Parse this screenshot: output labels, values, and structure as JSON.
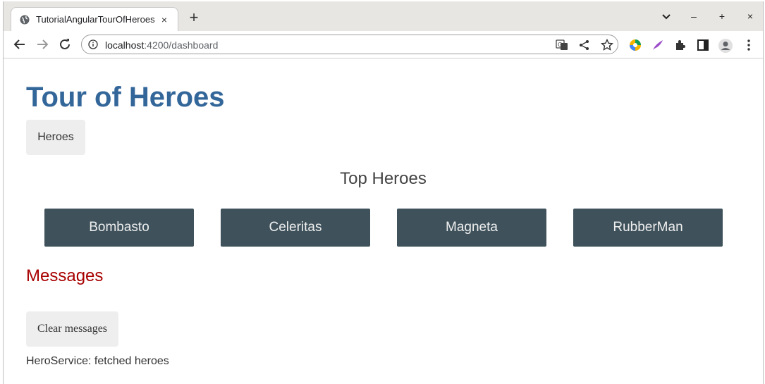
{
  "browser": {
    "tab_title": "TutorialAngularTourOfHeroes",
    "tab_close": "×",
    "new_tab": "+",
    "url_host": "localhost",
    "url_path": ":4200/dashboard",
    "window_controls": {
      "minimize": "–",
      "maximize": "+",
      "close": "×"
    }
  },
  "page": {
    "app_title": "Tour of Heroes",
    "nav": {
      "heroes_label": "Heroes"
    },
    "top_heroes_title": "Top Heroes",
    "heroes": [
      {
        "name": "Bombasto"
      },
      {
        "name": "Celeritas"
      },
      {
        "name": "Magneta"
      },
      {
        "name": "RubberMan"
      }
    ],
    "messages": {
      "title": "Messages",
      "clear_label": "Clear messages",
      "items": [
        "HeroService: fetched heroes"
      ]
    }
  },
  "colors": {
    "title": "#336699",
    "hero_card": "#3f525c",
    "messages_title": "#a80000"
  }
}
